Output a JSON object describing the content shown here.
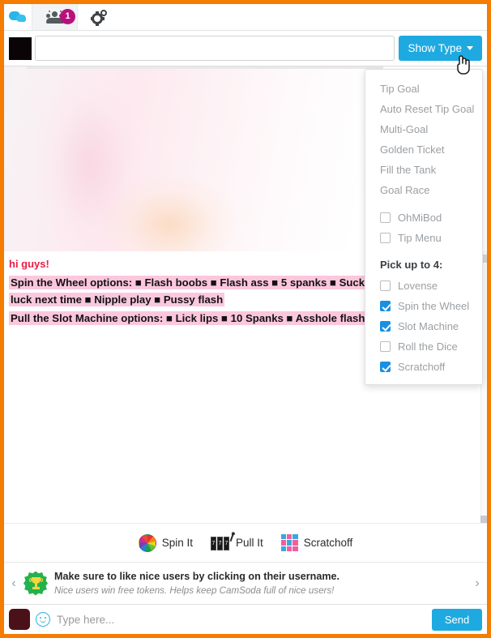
{
  "tabs": [
    {
      "id": "chat",
      "icon": "chat-bubble-icon",
      "label": "",
      "active": false
    },
    {
      "id": "users",
      "icon": "users-icon",
      "label": "",
      "badge": "1",
      "active": true
    },
    {
      "id": "settings",
      "icon": "gear-icon",
      "label": "",
      "active": false
    }
  ],
  "topic_bar": {
    "input_value": "",
    "input_placeholder": "",
    "show_type_label": "Show Type"
  },
  "chat": {
    "messages": [
      {
        "type": "name",
        "text": "hi guys!"
      },
      {
        "type": "highlight",
        "text": "Spin the Wheel options:   ■ Flash boobs   ■ Flash ass   ■ 5 spanks   ■ Suck your name   ■ Better luck next time   ■ Nipple play   ■ Pussy flash"
      },
      {
        "type": "highlight",
        "text": "Pull the Slot Machine options:   ■ Lick lips   ■ 10 Spanks   ■ Asshole flash   ■ Quick toy play"
      }
    ],
    "highlight_color": "#fcc7dd",
    "name_color": "#ec1c45"
  },
  "games": [
    {
      "label": "Spin It",
      "icon": "wheel-icon"
    },
    {
      "label": "Pull It",
      "icon": "slot-machine-icon"
    },
    {
      "label": "Scratchoff",
      "icon": "scratchoff-grid-icon"
    }
  ],
  "notice": {
    "prev_icon": "chevron-left-icon",
    "next_icon": "chevron-right-icon",
    "badge_icon": "trophy-badge-icon",
    "title": "Make sure to like nice users by clicking on their username.",
    "subtitle": "Nice users win free tokens. Helps keep CamSoda full of nice users!"
  },
  "input_bar": {
    "avatar": "user-avatar",
    "emoji_icon": "smiley-icon",
    "placeholder": "Type here...",
    "value": "",
    "send_label": "Send"
  },
  "dropdown": {
    "visible": true,
    "links": [
      "Tip Goal",
      "Auto Reset Tip Goal",
      "Multi-Goal",
      "Golden Ticket",
      "Fill the Tank",
      "Goal Race"
    ],
    "toggles": [
      {
        "label": "OhMiBod",
        "checked": false
      },
      {
        "label": "Tip Menu",
        "checked": false
      }
    ],
    "pick_heading": "Pick up to 4:",
    "picks": [
      {
        "label": "Lovense",
        "checked": false
      },
      {
        "label": "Spin the Wheel",
        "checked": true
      },
      {
        "label": "Slot Machine",
        "checked": true
      },
      {
        "label": "Roll the Dice",
        "checked": false
      },
      {
        "label": "Scratchoff",
        "checked": true
      }
    ]
  },
  "colors": {
    "window_border": "#f57c00",
    "accent_blue": "#1eaae0",
    "checkbox_blue": "#1a8fe3",
    "badge_magenta": "#b8117a"
  }
}
